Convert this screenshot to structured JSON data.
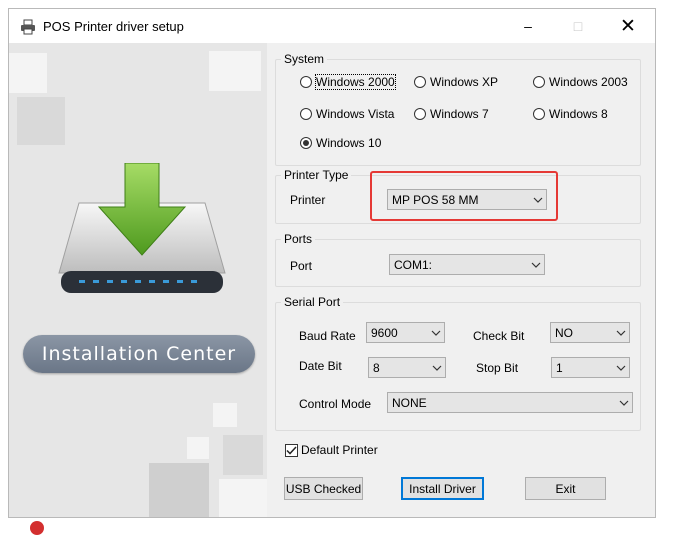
{
  "window": {
    "title": "POS Printer driver setup",
    "controls": {
      "minimize": "–",
      "maximize": "□",
      "close": "✕"
    }
  },
  "banner": {
    "label": "Installation Center"
  },
  "system": {
    "legend": "System",
    "options": [
      {
        "label": "Windows 2000",
        "selected": false
      },
      {
        "label": "Windows XP",
        "selected": false
      },
      {
        "label": "Windows 2003",
        "selected": false
      },
      {
        "label": "Windows Vista",
        "selected": false
      },
      {
        "label": "Windows 7",
        "selected": false
      },
      {
        "label": "Windows 8",
        "selected": false
      },
      {
        "label": "Windows 10",
        "selected": true
      }
    ]
  },
  "printer_type": {
    "legend": "Printer Type",
    "label": "Printer",
    "value": "MP POS 58 MM"
  },
  "ports": {
    "legend": "Ports",
    "label": "Port",
    "value": "COM1:"
  },
  "serial_port": {
    "legend": "Serial Port",
    "baud_rate": {
      "label": "Baud Rate",
      "value": "9600"
    },
    "check_bit": {
      "label": "Check Bit",
      "value": "NO"
    },
    "date_bit": {
      "label": "Date Bit",
      "value": "8"
    },
    "stop_bit": {
      "label": "Stop Bit",
      "value": "1"
    },
    "control_mode": {
      "label": "Control Mode",
      "value": "NONE"
    }
  },
  "default_printer": {
    "label": "Default Printer",
    "checked": true
  },
  "buttons": {
    "usb_checked": "USB Checked",
    "install_driver": "Install Driver",
    "exit": "Exit"
  },
  "colors": {
    "highlight": "#e53935",
    "focus_border": "#0078d7",
    "arrow_green": "#7cc242"
  }
}
